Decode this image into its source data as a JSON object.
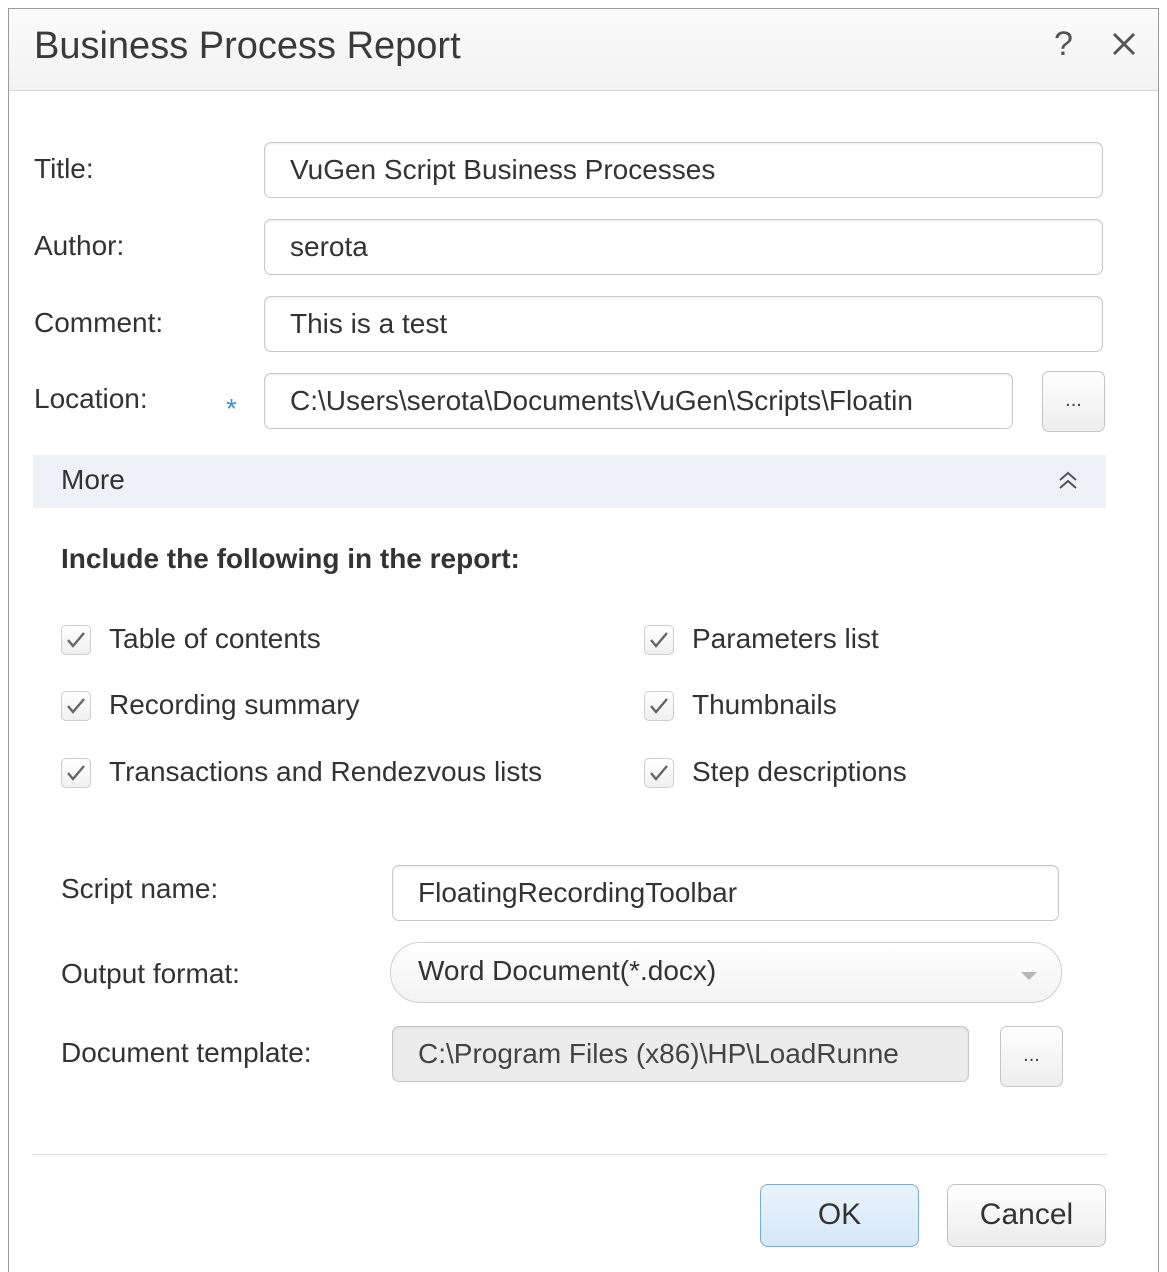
{
  "dialog": {
    "title": "Business Process Report",
    "help_label": "?",
    "close_icon": "close-icon"
  },
  "form": {
    "title_label": "Title:",
    "title_value": "VuGen Script Business Processes",
    "author_label": "Author:",
    "author_value": "serota",
    "comment_label": "Comment:",
    "comment_value": "This is a test",
    "location_label": "Location:",
    "location_required": "*",
    "location_value": "C:\\Users\\serota\\Documents\\VuGen\\Scripts\\Floatin",
    "browse_label": "..."
  },
  "more": {
    "label": "More",
    "icon": "double-chevron-up-icon"
  },
  "include": {
    "heading": "Include the following in the report:",
    "options": [
      {
        "label": "Table of contents",
        "checked": true
      },
      {
        "label": "Parameters list",
        "checked": true
      },
      {
        "label": "Recording summary",
        "checked": true
      },
      {
        "label": "Thumbnails",
        "checked": true
      },
      {
        "label": "Transactions and Rendezvous lists",
        "checked": true
      },
      {
        "label": "Step descriptions",
        "checked": true
      }
    ]
  },
  "details": {
    "script_name_label": "Script name:",
    "script_name_value": "FloatingRecordingToolbar",
    "output_format_label": "Output format:",
    "output_format_value": "Word Document(*.docx)",
    "document_template_label": "Document template:",
    "document_template_value": "C:\\Program Files (x86)\\HP\\LoadRunne",
    "browse_label": "..."
  },
  "buttons": {
    "ok": "OK",
    "cancel": "Cancel"
  },
  "colors": {
    "accent": "#3b8ee0",
    "primary_button_border": "#7aaad8",
    "more_bar_bg": "#eef1f5"
  }
}
